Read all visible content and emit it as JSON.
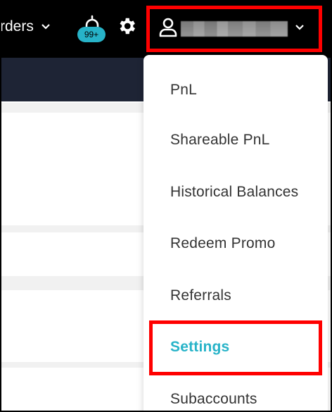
{
  "header": {
    "orders_label": "rders",
    "notification_count": "99+",
    "account": {
      "username": ""
    }
  },
  "account_menu": {
    "items": [
      {
        "label": "PnL"
      },
      {
        "label": "Shareable PnL"
      },
      {
        "label": "Historical Balances"
      },
      {
        "label": "Redeem Promo"
      },
      {
        "label": "Referrals"
      },
      {
        "label": "Settings",
        "active": true
      },
      {
        "label": "Subaccounts"
      }
    ]
  },
  "colors": {
    "accent": "#27b3c8",
    "topbar": "#000000",
    "subbar": "#1e2435",
    "annotation": "#ff0000"
  },
  "icons": [
    "chevron-down-icon",
    "bell-icon",
    "gear-icon",
    "user-icon"
  ]
}
